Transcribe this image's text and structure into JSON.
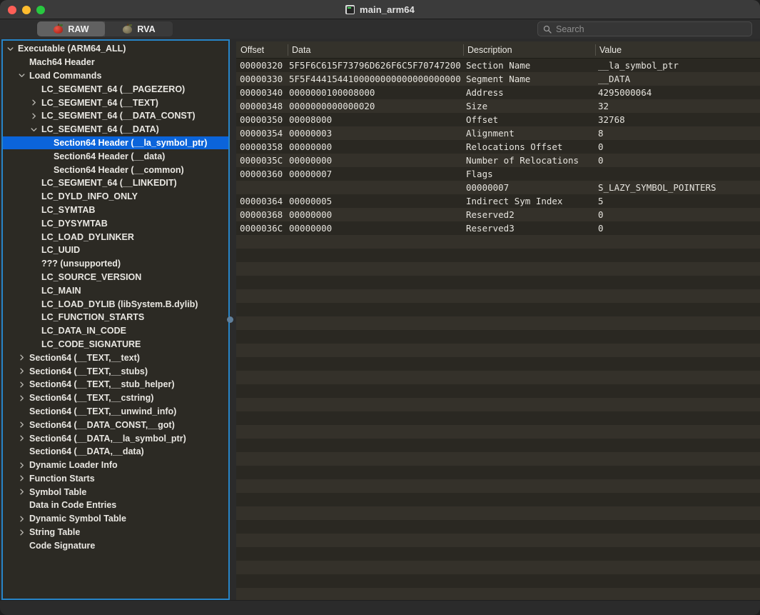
{
  "window": {
    "title": "main_arm64",
    "doc_icon": "terminal-document-icon",
    "traffic_lights": [
      "close",
      "minimize",
      "zoom"
    ]
  },
  "toolbar": {
    "tabs": [
      {
        "label": "RAW",
        "icon": "red-apple-icon",
        "selected": true
      },
      {
        "label": "RVA",
        "icon": "gray-apple-icon",
        "selected": false
      }
    ],
    "search": {
      "placeholder": "Search",
      "value": "",
      "icon": "search-icon"
    }
  },
  "sidebar": {
    "selected_index": 8,
    "items": [
      {
        "label": "Executable  (ARM64_ALL)",
        "level": 0,
        "disclosure": "expanded"
      },
      {
        "label": "Mach64 Header",
        "level": 1,
        "disclosure": "none"
      },
      {
        "label": "Load Commands",
        "level": 1,
        "disclosure": "expanded"
      },
      {
        "label": "LC_SEGMENT_64 (__PAGEZERO)",
        "level": 2,
        "disclosure": "none"
      },
      {
        "label": "LC_SEGMENT_64 (__TEXT)",
        "level": 2,
        "disclosure": "collapsed"
      },
      {
        "label": "LC_SEGMENT_64 (__DATA_CONST)",
        "level": 2,
        "disclosure": "collapsed"
      },
      {
        "label": "LC_SEGMENT_64 (__DATA)",
        "level": 2,
        "disclosure": "expanded"
      },
      {
        "label": "Section64 Header (__la_symbol_ptr)",
        "level": 3,
        "disclosure": "none",
        "selected": true
      },
      {
        "label": "Section64 Header (__data)",
        "level": 3,
        "disclosure": "none"
      },
      {
        "label": "Section64 Header (__common)",
        "level": 3,
        "disclosure": "none"
      },
      {
        "label": "LC_SEGMENT_64 (__LINKEDIT)",
        "level": 2,
        "disclosure": "none"
      },
      {
        "label": "LC_DYLD_INFO_ONLY",
        "level": 2,
        "disclosure": "none"
      },
      {
        "label": "LC_SYMTAB",
        "level": 2,
        "disclosure": "none"
      },
      {
        "label": "LC_DYSYMTAB",
        "level": 2,
        "disclosure": "none"
      },
      {
        "label": "LC_LOAD_DYLINKER",
        "level": 2,
        "disclosure": "none"
      },
      {
        "label": "LC_UUID",
        "level": 2,
        "disclosure": "none"
      },
      {
        "label": "??? (unsupported)",
        "level": 2,
        "disclosure": "none"
      },
      {
        "label": "LC_SOURCE_VERSION",
        "level": 2,
        "disclosure": "none"
      },
      {
        "label": "LC_MAIN",
        "level": 2,
        "disclosure": "none"
      },
      {
        "label": "LC_LOAD_DYLIB (libSystem.B.dylib)",
        "level": 2,
        "disclosure": "none"
      },
      {
        "label": "LC_FUNCTION_STARTS",
        "level": 2,
        "disclosure": "none"
      },
      {
        "label": "LC_DATA_IN_CODE",
        "level": 2,
        "disclosure": "none"
      },
      {
        "label": "LC_CODE_SIGNATURE",
        "level": 2,
        "disclosure": "none"
      },
      {
        "label": "Section64 (__TEXT,__text)",
        "level": 1,
        "disclosure": "collapsed"
      },
      {
        "label": "Section64 (__TEXT,__stubs)",
        "level": 1,
        "disclosure": "collapsed"
      },
      {
        "label": "Section64 (__TEXT,__stub_helper)",
        "level": 1,
        "disclosure": "collapsed"
      },
      {
        "label": "Section64 (__TEXT,__cstring)",
        "level": 1,
        "disclosure": "collapsed"
      },
      {
        "label": "Section64 (__TEXT,__unwind_info)",
        "level": 1,
        "disclosure": "none"
      },
      {
        "label": "Section64 (__DATA_CONST,__got)",
        "level": 1,
        "disclosure": "collapsed"
      },
      {
        "label": "Section64 (__DATA,__la_symbol_ptr)",
        "level": 1,
        "disclosure": "collapsed"
      },
      {
        "label": "Section64 (__DATA,__data)",
        "level": 1,
        "disclosure": "none"
      },
      {
        "label": "Dynamic Loader Info",
        "level": 1,
        "disclosure": "collapsed"
      },
      {
        "label": "Function Starts",
        "level": 1,
        "disclosure": "collapsed"
      },
      {
        "label": "Symbol Table",
        "level": 1,
        "disclosure": "collapsed"
      },
      {
        "label": "Data in Code Entries",
        "level": 1,
        "disclosure": "none"
      },
      {
        "label": "Dynamic Symbol Table",
        "level": 1,
        "disclosure": "collapsed"
      },
      {
        "label": "String Table",
        "level": 1,
        "disclosure": "collapsed"
      },
      {
        "label": "Code Signature",
        "level": 1,
        "disclosure": "none"
      }
    ]
  },
  "table": {
    "columns": [
      "Offset",
      "Data",
      "Description",
      "Value"
    ],
    "rows": [
      {
        "offset": "00000320",
        "data": "5F5F6C615F73796D626F6C5F70747200",
        "description": "Section Name",
        "value": "__la_symbol_ptr"
      },
      {
        "offset": "00000330",
        "data": "5F5F4441544100000000000000000000",
        "description": "Segment Name",
        "value": "__DATA"
      },
      {
        "offset": "00000340",
        "data": "0000000100008000",
        "description": "Address",
        "value": "4295000064"
      },
      {
        "offset": "00000348",
        "data": "0000000000000020",
        "description": "Size",
        "value": "32"
      },
      {
        "offset": "00000350",
        "data": "00008000",
        "description": "Offset",
        "value": "32768"
      },
      {
        "offset": "00000354",
        "data": "00000003",
        "description": "Alignment",
        "value": "8"
      },
      {
        "offset": "00000358",
        "data": "00000000",
        "description": "Relocations Offset",
        "value": "0"
      },
      {
        "offset": "0000035C",
        "data": "00000000",
        "description": "Number of Relocations",
        "value": "0"
      },
      {
        "offset": "00000360",
        "data": "00000007",
        "description": "Flags",
        "value": ""
      },
      {
        "offset": "",
        "data": "",
        "description": "00000007",
        "value": "S_LAZY_SYMBOL_POINTERS"
      },
      {
        "offset": "00000364",
        "data": "00000005",
        "description": "Indirect Sym Index",
        "value": "5"
      },
      {
        "offset": "00000368",
        "data": "00000000",
        "description": "Reserved2",
        "value": "0"
      },
      {
        "offset": "0000036C",
        "data": "00000000",
        "description": "Reserved3",
        "value": "0"
      }
    ],
    "empty_row_count": 27
  },
  "colors": {
    "selection_blue": "#0b64da",
    "focus_ring": "#2785c8",
    "row_even": "#2a2822",
    "row_odd": "#34312a",
    "header_bg": "#34322b"
  }
}
